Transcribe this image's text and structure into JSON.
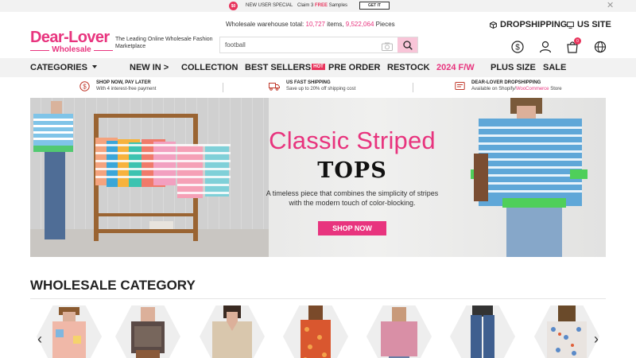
{
  "promo_bar": {
    "badge": "$0",
    "text1": "NEW USER SPECIAL",
    "text2_prefix": "Claim 3",
    "text2_highlight": "FREE",
    "text2_suffix": "Samples",
    "button": "GET IT",
    "close": "✕"
  },
  "header": {
    "logo_name": "Dear-Lover",
    "logo_sub": "Wholesale",
    "tagline": "The Leading Online Wholesale Fashion Marketplace",
    "warehouse_label": "Wholesale warehouse total:",
    "items_count": "10,727",
    "items_label": "items,",
    "pieces_count": "9,522,064",
    "pieces_label": "Pieces",
    "search_value": "football",
    "dropshipping": "DROPSHIPPING",
    "us_site": "US SITE",
    "cart_count": "0"
  },
  "nav": {
    "categories": "CATEGORIES",
    "items": [
      "NEW IN >",
      "COLLECTION",
      "BEST SELLERS",
      "PRE ORDER",
      "RESTOCK",
      "2024 F/W",
      "PLUS SIZE",
      "SALE"
    ],
    "hot_badge": "HOT"
  },
  "services": [
    {
      "title": "SHOP NOW, PAY LATER",
      "desc": "With 4 interest-free payment"
    },
    {
      "title": "US FAST SHIPPING",
      "desc": "Save up to 20% off shipping cost"
    },
    {
      "title": "DEAR-LOVER DROPSHIPPING",
      "desc_prefix": "Available on Shopify/",
      "desc_highlight": "WooCommerce",
      "desc_suffix": "Store"
    }
  ],
  "banner": {
    "title": "Classic Striped",
    "subtitle": "TOPS",
    "desc_line1": "A timeless piece that combines the simplicity of stripes",
    "desc_line2": "with the modern touch of color-blocking.",
    "button": "SHOP NOW"
  },
  "category_section": {
    "title": "WHOLESALE CATEGORY",
    "prev": "‹",
    "next": "›"
  },
  "colors": {
    "brand_pink": "#e8347e",
    "hot_red": "#e8345c",
    "nav_bg": "#f2f2f2"
  }
}
